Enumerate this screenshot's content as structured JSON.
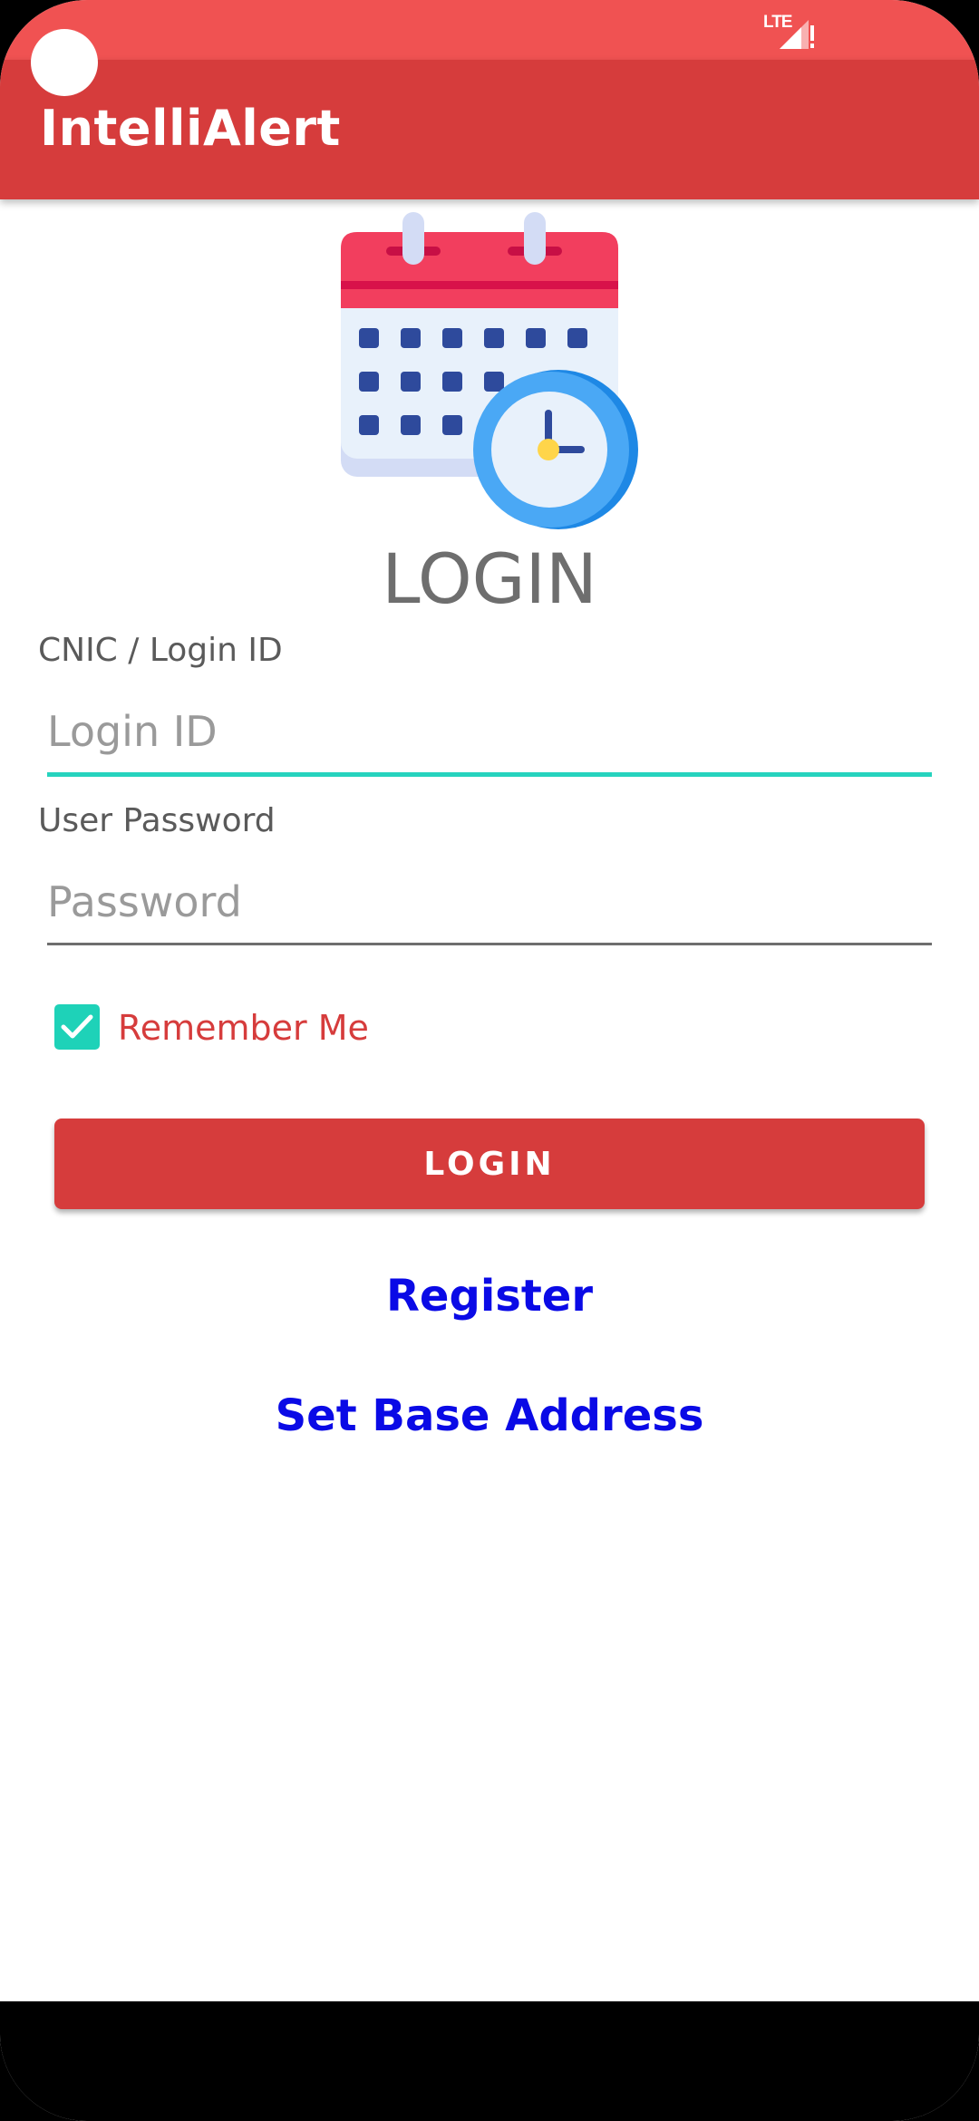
{
  "status_bar": {
    "network_label": "LTE"
  },
  "app_bar": {
    "title": "IntelliAlert"
  },
  "login": {
    "heading": "LOGIN",
    "login_id_label": "CNIC / Login ID",
    "login_id_placeholder": "Login ID",
    "login_id_value": "",
    "password_label": "User Password",
    "password_placeholder": "Password",
    "password_value": "",
    "remember_me_label": "Remember Me",
    "remember_me_checked": true,
    "button_label": "LOGIN",
    "register_link": "Register",
    "base_address_link": "Set Base Address"
  },
  "icons": {
    "logo": "calendar-clock-icon",
    "checkbox": "check-icon",
    "signal": "signal-alert-icon"
  },
  "colors": {
    "status_bar": "#f05252",
    "app_bar": "#d63c3c",
    "primary_button": "#d63c3c",
    "accent": "#1ed2b8",
    "link": "#0a0ae6"
  }
}
